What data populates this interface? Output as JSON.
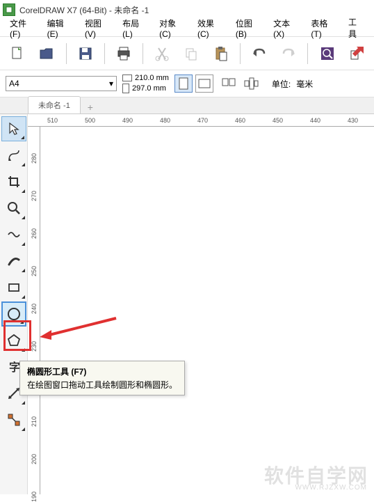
{
  "titlebar": {
    "app_name": "CorelDRAW X7 (64-Bit)",
    "doc_name": "未命名 -1"
  },
  "menu": {
    "file": "文件(F)",
    "edit": "编辑(E)",
    "view": "视图(V)",
    "layout": "布局(L)",
    "object": "对象(C)",
    "effects": "效果(C)",
    "bitmap": "位图(B)",
    "text": "文本(X)",
    "table": "表格(T)",
    "tools": "工具"
  },
  "toolbar": {
    "paper_size": "A4",
    "width": "210.0 mm",
    "height": "297.0 mm",
    "unit_label": "单位:",
    "unit_value": "毫米"
  },
  "tabs": {
    "doc1": "未命名 -1"
  },
  "ruler_h": [
    "510",
    "500",
    "490",
    "480",
    "470",
    "460",
    "450",
    "440",
    "430"
  ],
  "ruler_v": [
    "280",
    "270",
    "260",
    "250",
    "240",
    "230",
    "220",
    "210",
    "200",
    "190"
  ],
  "tooltip": {
    "title": "椭圆形工具 (F7)",
    "desc": "在绘图窗口拖动工具绘制圆形和椭圆形。"
  },
  "watermark": {
    "main": "软件自学网",
    "sub": "WWW.RJZXW.COM"
  },
  "icons": {
    "pick": "pick-tool",
    "shape": "shape-tool",
    "crop": "crop-tool",
    "zoom": "zoom-tool",
    "freehand": "freehand-tool",
    "artistic": "artistic-media-tool",
    "rectangle": "rectangle-tool",
    "ellipse": "ellipse-tool",
    "polygon": "polygon-tool",
    "text": "text-tool",
    "dimension": "dimension-tool",
    "connector": "connector-tool"
  }
}
